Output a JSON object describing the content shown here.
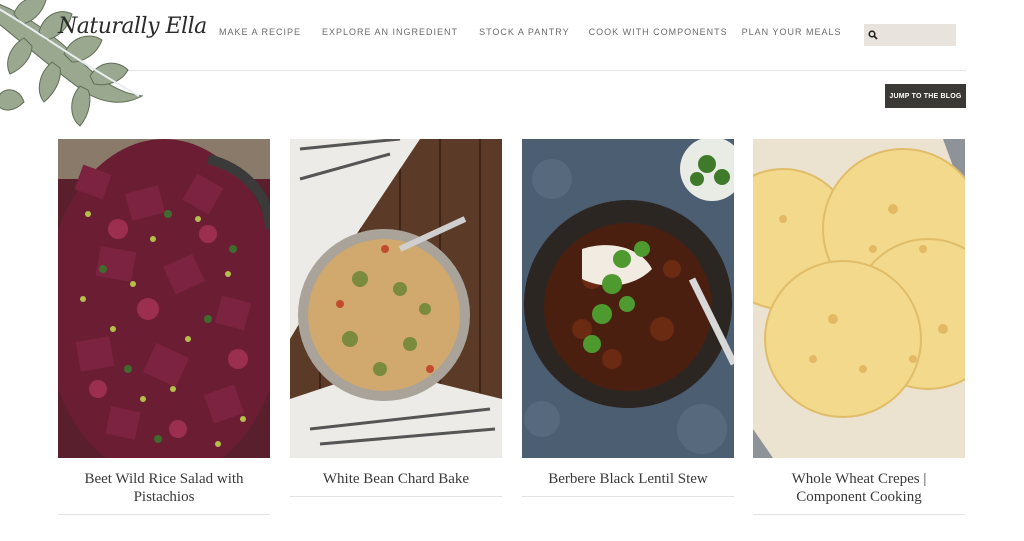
{
  "brand": {
    "logo_text": "Naturally Ella"
  },
  "nav": {
    "items": [
      {
        "label": "MAKE A RECIPE"
      },
      {
        "label": "EXPLORE AN INGREDIENT"
      },
      {
        "label": "STOCK A PANTRY"
      },
      {
        "label": "COOK WITH COMPONENTS"
      },
      {
        "label": "PLAN YOUR MEALS"
      }
    ]
  },
  "search": {
    "placeholder": "",
    "value": "",
    "icon": "search-icon"
  },
  "blog_button": {
    "label": "JUMP TO THE BLOG"
  },
  "cards": [
    {
      "title": "Beet Wild Rice Salad with Pistachios",
      "image": "beet-salad-photo"
    },
    {
      "title": "White Bean Chard Bake",
      "image": "bean-bake-photo"
    },
    {
      "title": "Berbere Black Lentil Stew",
      "image": "lentil-stew-photo"
    },
    {
      "title": "Whole Wheat Crepes | Component Cooking",
      "image": "crepes-photo"
    }
  ],
  "colors": {
    "nav_text": "#6b6b6b",
    "search_bg": "#e8e4dd",
    "button_bg": "#3b3935",
    "title_text": "#3a3a3a"
  }
}
